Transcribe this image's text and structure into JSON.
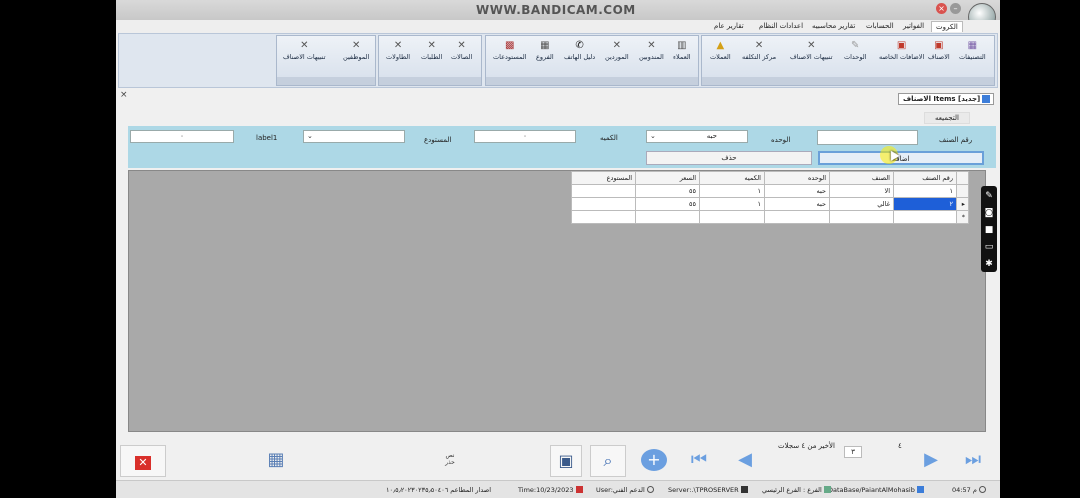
{
  "watermark": "WWW.BANDICAM.COM",
  "menu": [
    "الكروت",
    "الفواتير",
    "الحسابات",
    "تقارير محاسبيه",
    "اعدادات النظام",
    "تقارير عام"
  ],
  "ribbon_groups": [
    {
      "buttons": [
        {
          "label": "التصنيفات",
          "icon": "category-icon"
        },
        {
          "label": "الاصناف",
          "icon": "items-icon"
        },
        {
          "label": "الاضافات الخاصه",
          "icon": "addons-icon"
        },
        {
          "label": "الوحدات",
          "icon": "units-icon"
        },
        {
          "label": "تنبيهات الاصناف",
          "icon": "alerts-icon"
        },
        {
          "label": "مركز التكلفه",
          "icon": "cost-center-icon"
        },
        {
          "label": "العملات",
          "icon": "currency-icon"
        }
      ]
    },
    {
      "buttons": [
        {
          "label": "العملاء",
          "icon": "customers-icon"
        },
        {
          "label": "المندوبين",
          "icon": "delegates-icon"
        },
        {
          "label": "الموردين",
          "icon": "suppliers-icon"
        },
        {
          "label": "دليل الهاتف",
          "icon": "phone-icon"
        },
        {
          "label": "الفروع",
          "icon": "branches-icon"
        },
        {
          "label": "المستودعات",
          "icon": "warehouses-icon"
        }
      ]
    },
    {
      "buttons": [
        {
          "label": "الصالات",
          "icon": "halls-icon"
        },
        {
          "label": "الطلبات",
          "icon": "orders-icon"
        },
        {
          "label": "الطاولات",
          "icon": "tables-icon"
        }
      ]
    },
    {
      "buttons": [
        {
          "label": "الموظفين",
          "icon": "employees-icon"
        },
        {
          "label": "تنبيهات الاصناف",
          "icon": "alerts-icon"
        }
      ]
    }
  ],
  "doc_tab": "الاصناف Items [جديد]",
  "group_tab": "التجميعه",
  "form": {
    "item_no_label": "رقم الصنف",
    "item_no_value": "",
    "unit_label": "الوحده",
    "unit_value": "حبه",
    "qty_label": "الكميه",
    "qty_value": "٠",
    "warehouse_label": "المستودع",
    "warehouse_value": "",
    "label1": "label1",
    "extra_value": "٠",
    "add_button": "اضافه",
    "delete_button": "حذف"
  },
  "grid": {
    "columns": [
      "رقم الصنف",
      "الصنف",
      "الوحده",
      "الكميه",
      "السعر",
      "المستودع"
    ],
    "rows": [
      [
        "١",
        "الا",
        "حبه",
        "١",
        "٥٥",
        ""
      ],
      [
        "٢",
        "غالي",
        "حبه",
        "١",
        "٥٥",
        ""
      ],
      [
        "",
        "",
        "",
        "",
        "",
        ""
      ]
    ]
  },
  "nav": {
    "first_record_label": "الأخير من ٤ سجلات",
    "current_value": "٣",
    "total_value": "٤",
    "note": "نص حذر"
  },
  "status": {
    "time": "04:57 م",
    "database": "DataBase/PaiantAlMohasib",
    "branch": "الفرع : الفرع الرئيسي",
    "server": "Server:.\\TPROSERVER",
    "user": "User:الدعم الفني",
    "date": "Time:10/23/2023",
    "version": "اصدار المطاعم ١٠٫٥٫٢٠٢٣٠٢٣٥٫٥٠٤٠٦"
  },
  "colors": {
    "form_panel": "#add8e6",
    "grid_bg": "#a9a9a9",
    "selected_cell": "#1e5fd8",
    "accent_red": "#d9302b"
  }
}
